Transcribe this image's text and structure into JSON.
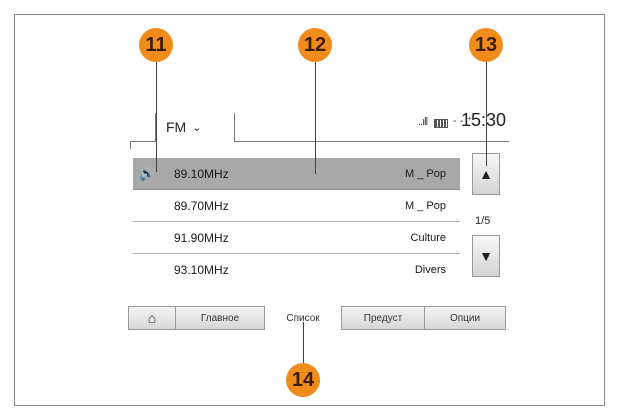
{
  "callouts": {
    "c11": "11",
    "c12": "12",
    "c13": "13",
    "c14": "14"
  },
  "status": {
    "band": "FM",
    "band_chevron": "⌄",
    "signal": "..ıll",
    "network": "- - ⁺",
    "clock": "15:30"
  },
  "stations": [
    {
      "freq": "89.10MHz",
      "name": "M _ Pop",
      "playing": true
    },
    {
      "freq": "89.70MHz",
      "name": "M _ Pop"
    },
    {
      "freq": "91.90MHz",
      "name": "Culture"
    },
    {
      "freq": "93.10MHz",
      "name": "Divers"
    }
  ],
  "icons": {
    "speaker": "🔊",
    "up": "▲",
    "down": "▼",
    "home": "⌂"
  },
  "pager": "1/5",
  "bottom_tabs": {
    "home": "⌂",
    "main": "Главное",
    "list": "Список",
    "presets": "Предуст",
    "options": "Опции"
  },
  "colors": {
    "callout": "#f08c1c",
    "selected_row": "#a8a8a8"
  }
}
